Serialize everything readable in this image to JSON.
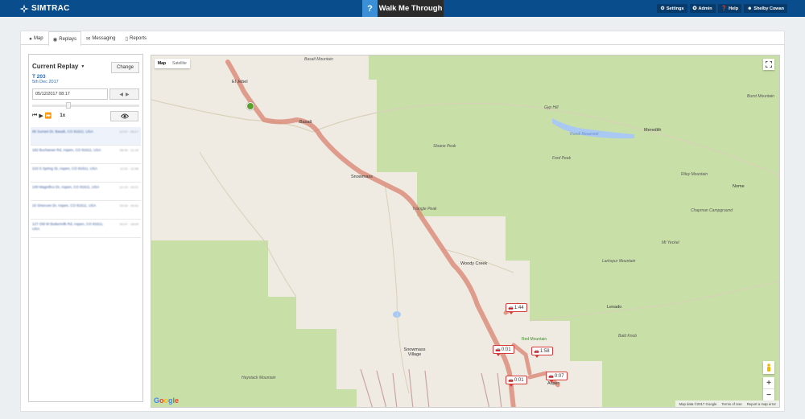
{
  "app": {
    "name": "SIMTRAC"
  },
  "walk_me": {
    "icon": "?",
    "label": "Walk Me Through"
  },
  "topnav": [
    {
      "label": "Settings",
      "icon": "gear-icon"
    },
    {
      "label": "Admin",
      "icon": "admin-icon"
    },
    {
      "label": "Help",
      "icon": "help-icon"
    },
    {
      "label": "Shelby Cowan",
      "icon": "user-icon"
    }
  ],
  "tabs": [
    {
      "label": "Map",
      "icon": "globe-icon",
      "active": false
    },
    {
      "label": "Replays",
      "icon": "play-circle-icon",
      "active": true
    },
    {
      "label": "Messaging",
      "icon": "envelope-icon",
      "active": false
    },
    {
      "label": "Reports",
      "icon": "file-icon",
      "active": false
    }
  ],
  "replay": {
    "title": "Current Replay",
    "change_label": "Change",
    "vehicle": "T 203",
    "date": "5th Dec 2017",
    "datetime_value": "05/12/2017 08:17",
    "speed": "1x",
    "stops": [
      {
        "address": "86 Sunset Dr, Basalt, CO 81621, USA",
        "time": "12:07 - 08:17"
      },
      {
        "address": "182 Buchanan Rd, Aspen, CO 81611, USA",
        "time": "08:30 - 11:15"
      },
      {
        "address": "210 S Spring St, Aspen, CO 81611, USA",
        "time": "11:31 - 11:58"
      },
      {
        "address": "100 Magnifico Dr, Aspen, CO 81611, USA",
        "time": "12:13 - 15:21"
      },
      {
        "address": "15 Sinecure Dr, Aspen, CO 81611, USA",
        "time": "15:33 - 16:32"
      },
      {
        "address": "127 Old W Buttermilk Rd, Aspen, CO 81611, USA",
        "time": "16:47 - 18:05"
      }
    ]
  },
  "map": {
    "toggle": [
      "Map",
      "Satellite"
    ],
    "attribution": [
      "Map data ©2017 Google",
      "Terms of Use",
      "Report a map error"
    ],
    "places": [
      {
        "name": "Basalt Mountain"
      },
      {
        "name": "El Jebel"
      },
      {
        "name": "Basalt"
      },
      {
        "name": "Gyp Hill"
      },
      {
        "name": "Burnt Mountain"
      },
      {
        "name": "Meredith"
      },
      {
        "name": "Ruedi Reservoir"
      },
      {
        "name": "Sloane Peak"
      },
      {
        "name": "Ford Peak"
      },
      {
        "name": "Snowmass"
      },
      {
        "name": "Riley Mountain"
      },
      {
        "name": "Nome"
      },
      {
        "name": "Triangle Peak"
      },
      {
        "name": "Chapman Campground"
      },
      {
        "name": "Mt Yeckel"
      },
      {
        "name": "Woody Creek"
      },
      {
        "name": "Larkspur Mountain"
      },
      {
        "name": "Lenado"
      },
      {
        "name": "Red Mountain"
      },
      {
        "name": "Bald Knob"
      },
      {
        "name": "Snowmass Village"
      },
      {
        "name": "Haystack Mountain"
      },
      {
        "name": "Aspen"
      }
    ],
    "markers": [
      "1:44",
      "1:58",
      "0:01",
      "0:07",
      "0:01"
    ]
  }
}
